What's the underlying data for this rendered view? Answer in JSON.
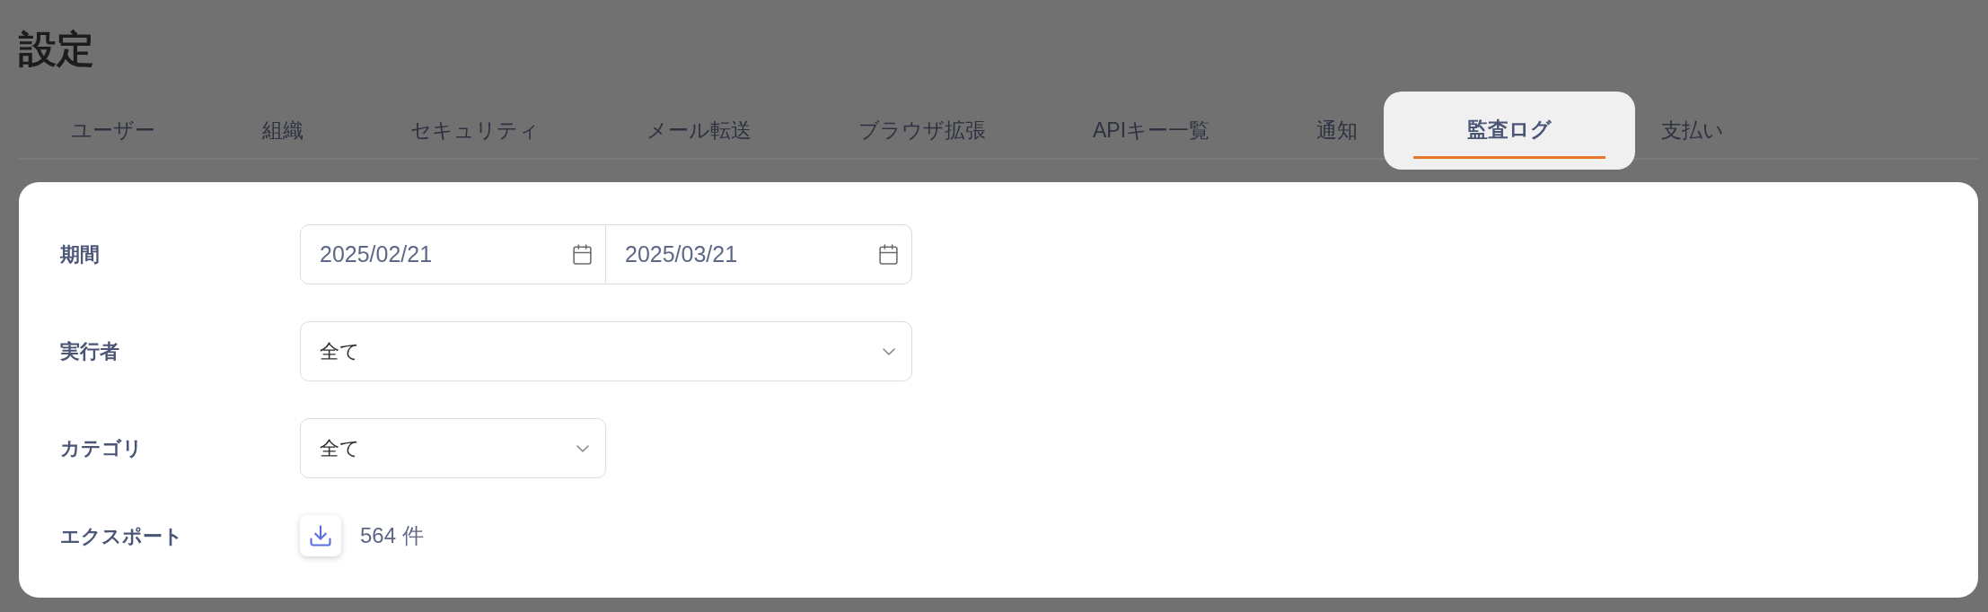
{
  "page": {
    "title": "設定"
  },
  "tabs": [
    {
      "label": "ユーザー",
      "selected": false
    },
    {
      "label": "組織",
      "selected": false
    },
    {
      "label": "セキュリティ",
      "selected": false
    },
    {
      "label": "メール転送",
      "selected": false
    },
    {
      "label": "ブラウザ拡張",
      "selected": false
    },
    {
      "label": "APIキー一覧",
      "selected": false
    },
    {
      "label": "通知",
      "selected": false
    },
    {
      "label": "監査ログ",
      "selected": true
    },
    {
      "label": "支払い",
      "selected": false
    }
  ],
  "form": {
    "period": {
      "label": "期間",
      "start_date": "2025/02/21",
      "end_date": "2025/03/21"
    },
    "actor": {
      "label": "実行者",
      "value": "全て"
    },
    "category": {
      "label": "カテゴリ",
      "value": "全て"
    },
    "export": {
      "label": "エクスポート",
      "count": "564 件"
    }
  }
}
